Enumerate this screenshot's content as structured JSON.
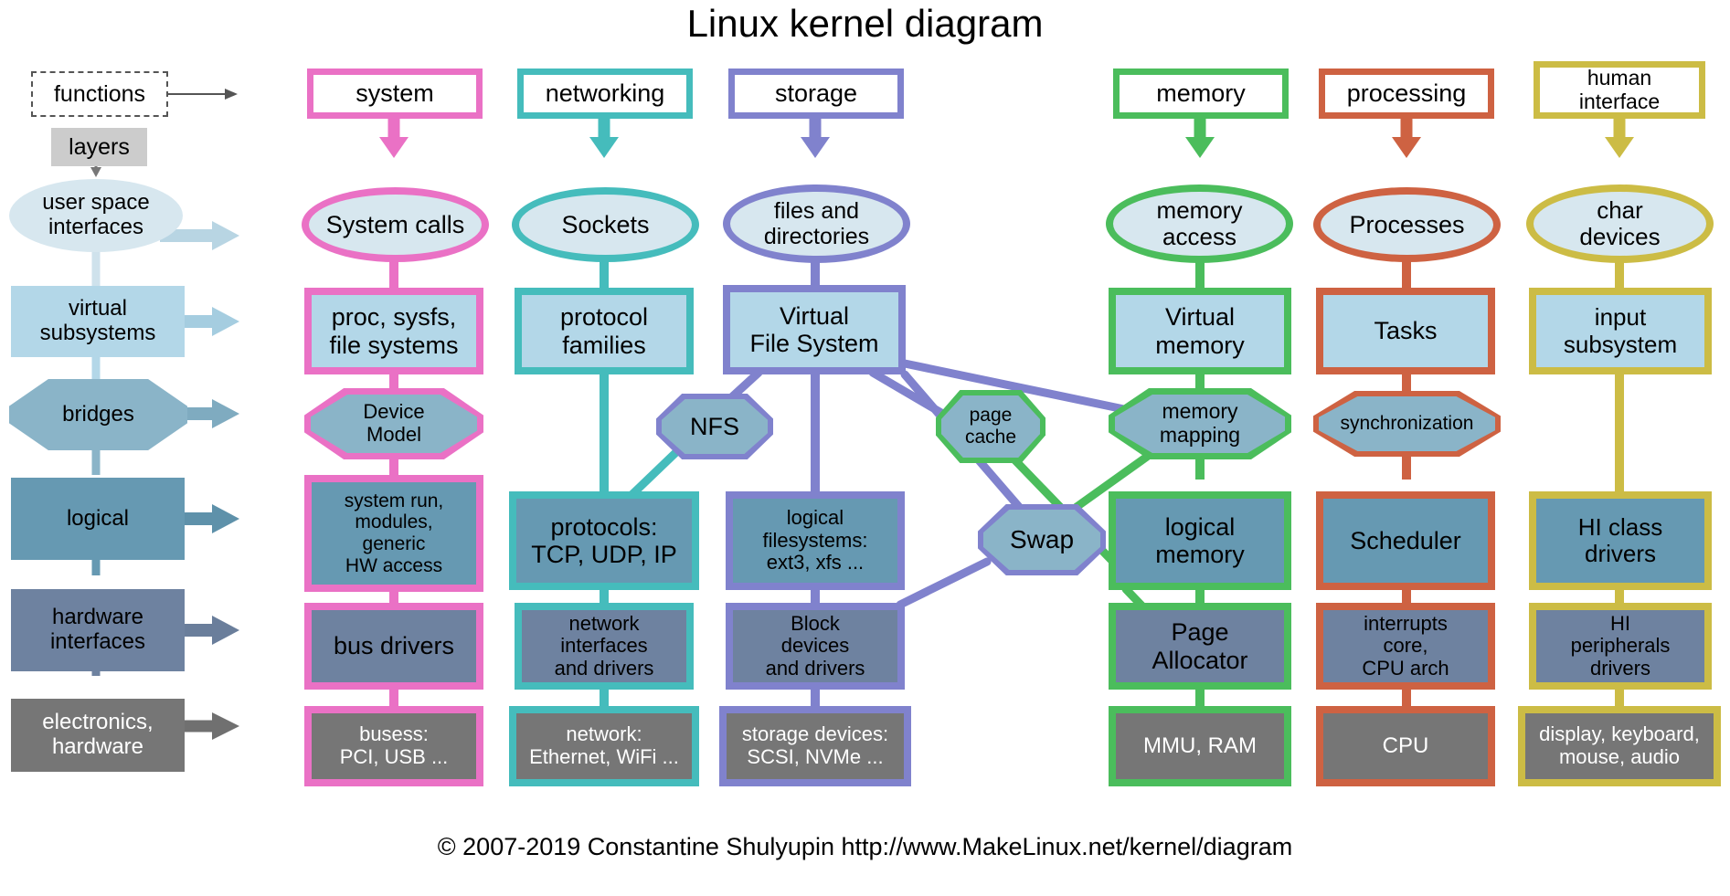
{
  "title": "Linux kernel diagram",
  "footer": "© 2007-2019 Constantine Shulyupin http://www.MakeLinux.net/kernel/diagram",
  "legend": {
    "functions": "functions",
    "layers": "layers"
  },
  "layer_colors": {
    "user_space": "#d7e7ef",
    "virtual_subsystems": "#b3d7e8",
    "bridges": "#8ab4c8",
    "logical": "#6699b2",
    "hardware_interfaces": "#6e82a0",
    "electronics": "#767676"
  },
  "layers": [
    {
      "id": "user-space-interfaces",
      "label": "user space\ninterfaces",
      "shape": "ellipse",
      "fill": "#d7e7ef"
    },
    {
      "id": "virtual-subsystems",
      "label": "virtual\nsubsystems",
      "shape": "rect",
      "fill": "#b3d7e8"
    },
    {
      "id": "bridges",
      "label": "bridges",
      "shape": "octagon",
      "fill": "#8ab4c8"
    },
    {
      "id": "logical",
      "label": "logical",
      "shape": "rect",
      "fill": "#6699b2"
    },
    {
      "id": "hardware-interfaces",
      "label": "hardware\ninterfaces",
      "shape": "rect",
      "fill": "#6e82a0"
    },
    {
      "id": "electronics-hardware",
      "label": "electronics,\nhardware",
      "shape": "rect",
      "fill": "#767676"
    }
  ],
  "columns": [
    {
      "id": "system",
      "header": "system",
      "color": "#ea71c5",
      "nodes": [
        {
          "id": "system-calls",
          "label": "System calls",
          "shape": "ellipse",
          "layer": "user_space"
        },
        {
          "id": "proc-sysfs",
          "label": "proc, sysfs,\nfile systems",
          "shape": "rect",
          "layer": "virtual_subsystems"
        },
        {
          "id": "device-model",
          "label": "Device\nModel",
          "shape": "octagon",
          "layer": "bridges"
        },
        {
          "id": "system-run",
          "label": "system run,\nmodules,\ngeneric\nHW access",
          "shape": "rect",
          "layer": "logical"
        },
        {
          "id": "bus-drivers",
          "label": "bus drivers",
          "shape": "rect",
          "layer": "hardware_interfaces"
        },
        {
          "id": "busess",
          "label": "busess:\nPCI, USB ...",
          "shape": "rect",
          "layer": "electronics"
        }
      ]
    },
    {
      "id": "networking",
      "header": "networking",
      "color": "#45bcbc",
      "nodes": [
        {
          "id": "sockets",
          "label": "Sockets",
          "shape": "ellipse",
          "layer": "user_space"
        },
        {
          "id": "protocol-families",
          "label": "protocol\nfamilies",
          "shape": "rect",
          "layer": "virtual_subsystems"
        },
        {
          "id": "protocols",
          "label": "protocols:\nTCP, UDP, IP",
          "shape": "rect",
          "layer": "logical"
        },
        {
          "id": "network-interfaces",
          "label": "network\ninterfaces\nand drivers",
          "shape": "rect",
          "layer": "hardware_interfaces"
        },
        {
          "id": "network-devices",
          "label": "network:\nEthernet, WiFi ...",
          "shape": "rect",
          "layer": "electronics"
        }
      ]
    },
    {
      "id": "storage",
      "header": "storage",
      "color": "#8082cd",
      "nodes": [
        {
          "id": "files-and-directories",
          "label": "files and\ndirectories",
          "shape": "ellipse",
          "layer": "user_space"
        },
        {
          "id": "virtual-file-system",
          "label": "Virtual\nFile System",
          "shape": "rect",
          "layer": "virtual_subsystems"
        },
        {
          "id": "logical-filesystems",
          "label": "logical\nfilesystems:\next3, xfs ...",
          "shape": "rect",
          "layer": "logical"
        },
        {
          "id": "block-devices",
          "label": "Block\ndevices\nand drivers",
          "shape": "rect",
          "layer": "hardware_interfaces"
        },
        {
          "id": "storage-devices",
          "label": "storage devices:\nSCSI, NVMe ...",
          "shape": "rect",
          "layer": "electronics"
        }
      ]
    },
    {
      "id": "memory",
      "header": "memory",
      "color": "#4bbd5c",
      "nodes": [
        {
          "id": "memory-access",
          "label": "memory\naccess",
          "shape": "ellipse",
          "layer": "user_space"
        },
        {
          "id": "virtual-memory",
          "label": "Virtual\nmemory",
          "shape": "rect",
          "layer": "virtual_subsystems"
        },
        {
          "id": "memory-mapping",
          "label": "memory\nmapping",
          "shape": "octagon",
          "layer": "bridges"
        },
        {
          "id": "logical-memory",
          "label": "logical\nmemory",
          "shape": "rect",
          "layer": "logical"
        },
        {
          "id": "page-allocator",
          "label": "Page\nAllocator",
          "shape": "rect",
          "layer": "hardware_interfaces"
        },
        {
          "id": "mmu-ram",
          "label": "MMU, RAM",
          "shape": "rect",
          "layer": "electronics"
        }
      ]
    },
    {
      "id": "processing",
      "header": "processing",
      "color": "#ce6242",
      "nodes": [
        {
          "id": "processes",
          "label": "Processes",
          "shape": "ellipse",
          "layer": "user_space"
        },
        {
          "id": "tasks",
          "label": "Tasks",
          "shape": "rect",
          "layer": "virtual_subsystems"
        },
        {
          "id": "synchronization",
          "label": "synchronization",
          "shape": "octagon",
          "layer": "bridges"
        },
        {
          "id": "scheduler",
          "label": "Scheduler",
          "shape": "rect",
          "layer": "logical"
        },
        {
          "id": "interrupts-core",
          "label": "interrupts\ncore,\nCPU arch",
          "shape": "rect",
          "layer": "hardware_interfaces"
        },
        {
          "id": "cpu",
          "label": "CPU",
          "shape": "rect",
          "layer": "electronics"
        }
      ]
    },
    {
      "id": "human-interface",
      "header": "human\ninterface",
      "color": "#ccbc45",
      "nodes": [
        {
          "id": "char-devices",
          "label": "char\ndevices",
          "shape": "ellipse",
          "layer": "user_space"
        },
        {
          "id": "input-subsystem",
          "label": "input\nsubsystem",
          "shape": "rect",
          "layer": "virtual_subsystems"
        },
        {
          "id": "hi-class-drivers",
          "label": "HI class\ndrivers",
          "shape": "rect",
          "layer": "logical"
        },
        {
          "id": "hi-peripherals",
          "label": "HI\nperipherals\ndrivers",
          "shape": "rect",
          "layer": "hardware_interfaces"
        },
        {
          "id": "hi-hardware",
          "label": "display, keyboard,\nmouse, audio",
          "shape": "rect",
          "layer": "electronics"
        }
      ]
    }
  ],
  "cross_nodes": [
    {
      "id": "nfs",
      "label": "NFS",
      "shape": "octagon",
      "border": "#8082cd",
      "fill": "#8ab4c8"
    },
    {
      "id": "page-cache",
      "label": "page\ncache",
      "shape": "octagon",
      "border": "#4bbd5c",
      "fill": "#8ab4c8"
    },
    {
      "id": "swap",
      "label": "Swap",
      "shape": "octagon",
      "border": "#8082cd",
      "fill": "#8ab4c8"
    }
  ],
  "connections": [
    {
      "from": "virtual-file-system",
      "to": "nfs",
      "color": "#8082cd"
    },
    {
      "from": "nfs",
      "to": "protocols",
      "color": "#45bcbc"
    },
    {
      "from": "virtual-file-system",
      "to": "page-cache",
      "color": "#8082cd"
    },
    {
      "from": "virtual-file-system",
      "to": "memory-mapping",
      "color": "#8082cd"
    },
    {
      "from": "page-cache",
      "to": "logical-memory",
      "color": "#4bbd5c"
    },
    {
      "from": "memory-mapping",
      "to": "logical-memory",
      "color": "#4bbd5c"
    },
    {
      "from": "swap",
      "to": "block-devices",
      "color": "#8082cd"
    },
    {
      "from": "logical-memory",
      "to": "page-allocator",
      "color": "#4bbd5c"
    }
  ]
}
